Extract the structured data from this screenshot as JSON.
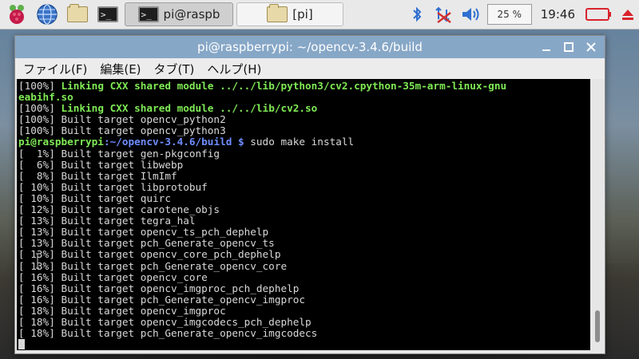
{
  "taskbar": {
    "tasks": [
      {
        "label": "pi@raspb"
      },
      {
        "label": "[pi]"
      }
    ],
    "cpu": "25 %",
    "clock": "19:46"
  },
  "window": {
    "title": "pi@raspberrypi: ~/opencv-3.4.6/build",
    "menu": [
      "ファイル(F)",
      "編集(E)",
      "タブ(T)",
      "ヘルプ(H)"
    ]
  },
  "terminal": {
    "link_lines": [
      {
        "prefix": "[100%] ",
        "text": "Linking CXX shared module ../../lib/python3/cv2.cpython-35m-arm-linux-gnu"
      },
      {
        "text": "eabihf.so"
      },
      {
        "prefix": "[100%] ",
        "text": "Linking CXX shared module ../../lib/cv2.so"
      }
    ],
    "pre_lines": [
      "[100%] Built target opencv_python2",
      "[100%] Built target opencv_python3"
    ],
    "prompt": {
      "user": "pi@raspberrypi",
      "path": ":~/opencv-3.4.6/build $",
      "command": " sudo make install"
    },
    "lines": [
      "[  1%] Built target gen-pkgconfig",
      "[  6%] Built target libwebp",
      "[  8%] Built target IlmImf",
      "[ 10%] Built target libprotobuf",
      "[ 10%] Built target quirc",
      "[ 12%] Built target carotene_objs",
      "[ 13%] Built target tegra_hal",
      "[ 13%] Built target opencv_ts_pch_dephelp",
      "[ 13%] Built target pch_Generate_opencv_ts",
      "[ 13%] Built target opencv_core_pch_dephelp",
      "[ 13%] Built target pch_Generate_opencv_core",
      "[ 16%] Built target opencv_core",
      "[ 16%] Built target opencv_imgproc_pch_dephelp",
      "[ 16%] Built target pch_Generate_opencv_imgproc",
      "[ 18%] Built target opencv_imgproc",
      "[ 18%] Built target opencv_imgcodecs_pch_dephelp",
      "[ 18%] Built target pch_Generate_opencv_imgcodecs"
    ]
  }
}
